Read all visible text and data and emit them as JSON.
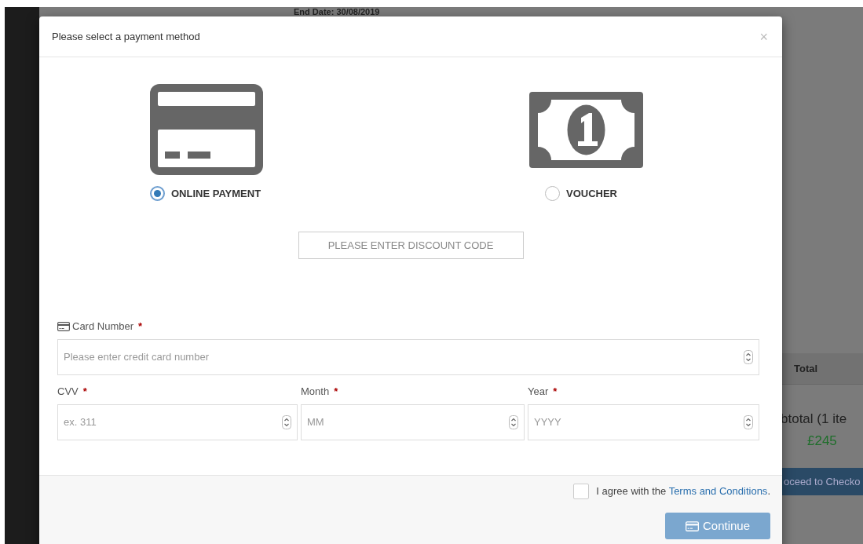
{
  "background": {
    "end_date": "End Date: 30/08/2019",
    "table_header": "Total",
    "subtotal": "btotal (1 ite",
    "amount": "£245",
    "checkout_button": "oceed to Checko"
  },
  "modal": {
    "title": "Please select a payment method",
    "close": "×",
    "payment_methods": [
      {
        "kind": "card",
        "label": "ONLINE PAYMENT",
        "selected": true
      },
      {
        "kind": "cash",
        "label": "VOUCHER",
        "selected": false
      }
    ],
    "discount": {
      "placeholder": "PLEASE ENTER DISCOUNT CODE"
    },
    "card_number": {
      "label": "Card Number",
      "required_mark": "*",
      "placeholder": "Please enter credit card number"
    },
    "fields": [
      {
        "label": "CVV",
        "required_mark": "*",
        "placeholder": "ex. 311"
      },
      {
        "label": "Month",
        "required_mark": "*",
        "placeholder": "MM"
      },
      {
        "label": "Year",
        "required_mark": "*",
        "placeholder": "YYYY"
      }
    ],
    "agree": {
      "checked": false,
      "text": "I agree with the",
      "link": "Terms and Conditions",
      "suffix": "."
    },
    "continue": {
      "label": "Continue",
      "disabled": true
    }
  }
}
